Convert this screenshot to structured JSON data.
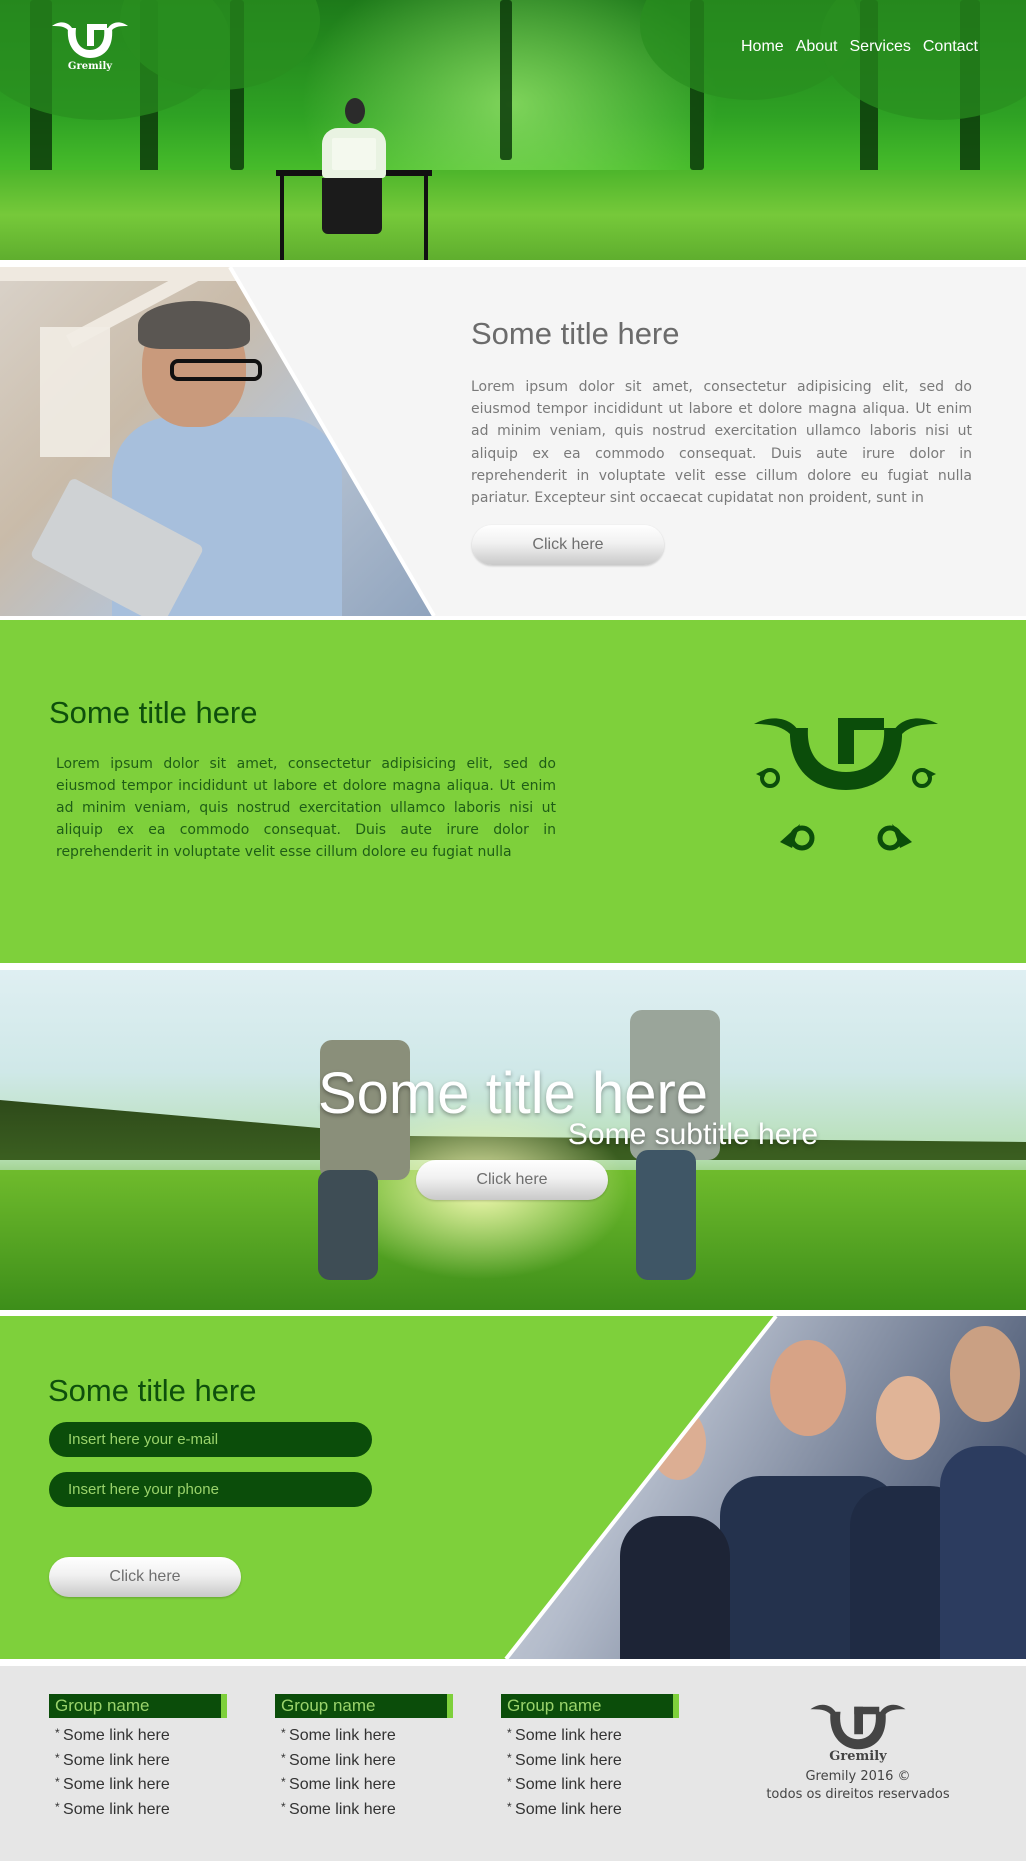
{
  "header": {
    "brand": "Gremily",
    "nav": [
      "Home",
      "About",
      "Services",
      "Contact"
    ]
  },
  "section_about": {
    "title": "Some title here",
    "body": "Lorem ipsum dolor sit amet, consectetur adipisicing elit, sed do eiusmod tempor incididunt ut labore et dolore magna aliqua. Ut enim ad minim veniam, quis nostrud exercitation ullamco laboris nisi ut aliquip ex ea commodo consequat. Duis aute irure dolor in reprehenderit in voluptate velit esse cillum dolore eu fugiat nulla pariatur. Excepteur sint occaecat cupidatat non proident, sunt in",
    "button": "Click here"
  },
  "section_green": {
    "title": "Some title here",
    "body": "Lorem ipsum dolor sit amet, consectetur adipisicing elit, sed do eiusmod tempor incididunt ut labore et dolore magna aliqua. Ut enim ad minim veniam, quis nostrud exercitation ullamco laboris nisi ut aliquip ex ea commodo consequat. Duis aute irure dolor in reprehenderit in voluptate velit esse cillum dolore eu fugiat nulla"
  },
  "section_banner": {
    "title": "Some title here",
    "subtitle": "Some subtitle here",
    "button": "Click here"
  },
  "section_form": {
    "title": "Some title here",
    "email_placeholder": "Insert here your e-mail",
    "phone_placeholder": "Insert here your phone",
    "button": "Click here"
  },
  "footer": {
    "groups": [
      {
        "name": "Group name",
        "links": [
          "Some link here",
          "Some link here",
          "Some link here",
          "Some link here"
        ]
      },
      {
        "name": "Group name",
        "links": [
          "Some link here",
          "Some link here",
          "Some link here",
          "Some link here"
        ]
      },
      {
        "name": "Group name",
        "links": [
          "Some link here",
          "Some link here",
          "Some link here",
          "Some link here"
        ]
      }
    ],
    "brand": "Gremily",
    "copyright_line1": "Gremily  2016 ©",
    "copyright_line2": "todos os direitos reservados"
  },
  "colors": {
    "accent_green": "#7ed03b",
    "dark_green": "#0b4d0a",
    "light_green_text": "#9ad36b",
    "footer_bg": "#e6e6e6",
    "section_bg": "#f5f5f5"
  },
  "icons": [
    "gremily-logo-icon",
    "gremily-emblem-icon"
  ]
}
